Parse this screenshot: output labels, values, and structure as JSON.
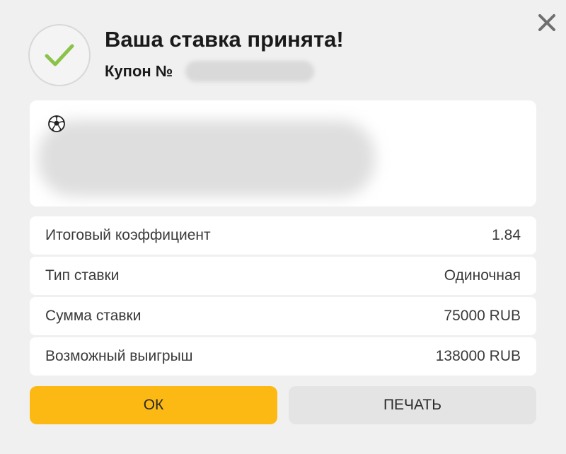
{
  "dialog": {
    "title": "Ваша ставка принята!",
    "coupon_label": "Купон №"
  },
  "event": {
    "sport_icon": "soccer-ball-icon"
  },
  "details": [
    {
      "label": "Итоговый коэффициент",
      "value": "1.84"
    },
    {
      "label": "Тип ставки",
      "value": "Одиночная"
    },
    {
      "label": "Сумма ставки",
      "value": "75000 RUB"
    },
    {
      "label": "Возможный выигрыш",
      "value": "138000 RUB"
    }
  ],
  "buttons": {
    "ok": "ОК",
    "print": "ПЕЧАТЬ"
  },
  "colors": {
    "accent": "#fdb913",
    "check": "#8bc34a",
    "background": "#f0f0f0"
  }
}
